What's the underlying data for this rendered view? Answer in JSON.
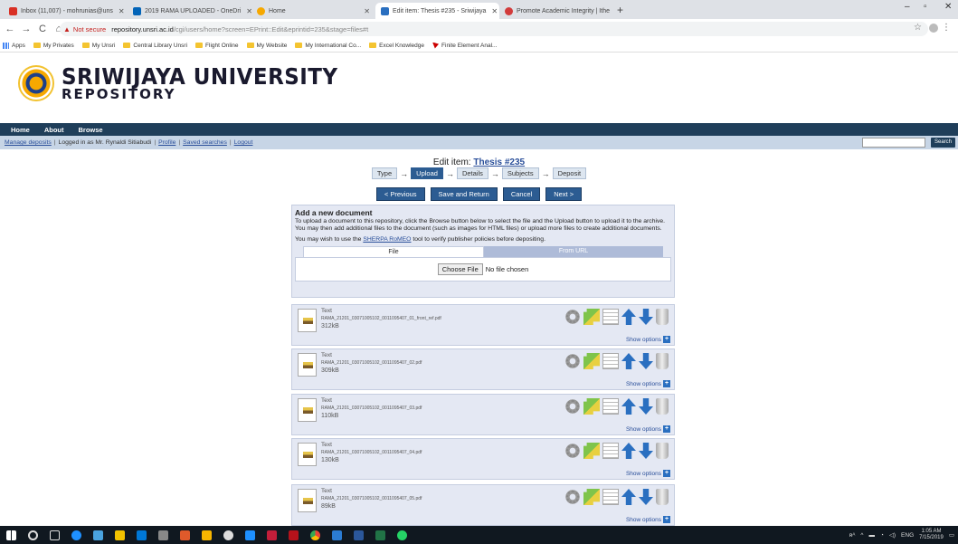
{
  "tabs": [
    {
      "title": "Inbox (11,007) - mohrunias@uns",
      "icon": "gmail-icon",
      "color": "#d93025"
    },
    {
      "title": "2019 RAMA UPLOADED - OneDri",
      "icon": "onedrive-icon",
      "color": "#0364b8"
    },
    {
      "title": "Home",
      "icon": "sriwijaya-icon",
      "color": "#f6a800"
    },
    {
      "title": "Edit item: Thesis #235 - Sriwijaya",
      "icon": "eprints-icon",
      "color": "#2a6fc0"
    },
    {
      "title": "Promote Academic Integrity | Ithe",
      "icon": "ithenticate-icon",
      "color": "#d23b3b"
    }
  ],
  "address": {
    "not_secure": "Not secure",
    "host": "repository.unsri.ac.id",
    "path": "/cgi/users/home?screen=EPrint::Edit&eprintid=235&stage=files#t"
  },
  "bookmarks": [
    "Apps",
    "My Privates",
    "My Unsri",
    "Central Library Unsri",
    "Flight Online",
    "My Website",
    "My International Co...",
    "Excel Knowledge",
    "Finite Element Anal..."
  ],
  "site": {
    "name": "SRIWIJAYA UNIVERSITY",
    "sub": "REPOSITORY"
  },
  "menu": [
    "Home",
    "About",
    "Browse"
  ],
  "userbar": {
    "manage": "Manage deposits",
    "logged": "Logged in as Mr. Rynaldi Sitiabudi",
    "profile": "Profile",
    "saved": "Saved searches",
    "logout": "Logout",
    "search_btn": "Search"
  },
  "edit": {
    "prefix": "Edit item: ",
    "item": "Thesis #235"
  },
  "steps": [
    "Type",
    "Upload",
    "Details",
    "Subjects",
    "Deposit"
  ],
  "buttons": {
    "prev": "< Previous",
    "save": "Save and Return",
    "cancel": "Cancel",
    "next": "Next >"
  },
  "upload_panel": {
    "heading": "Add a new document",
    "text1": "To upload a document to this repository, click the Browse button below to select the file and the Upload button to upload it to the archive. You may then add additional files to the document (such as images for HTML files) or upload more files to create additional documents.",
    "text2_pre": "You may wish to use the ",
    "text2_link": "SHERPA RoMEO",
    "text2_post": " tool to verify publisher policies before depositing.",
    "tab_file": "File",
    "tab_url": "From URL",
    "choose": "Choose File",
    "no_file": "No file chosen"
  },
  "documents": [
    {
      "type": "Text",
      "name": "RAMA_21201_03071005102_0011095407_01_front_ref.pdf",
      "size": "312kB",
      "show": "Show options"
    },
    {
      "type": "Text",
      "name": "RAMA_21201_03071005102_0011095407_02.pdf",
      "size": "309kB",
      "show": "Show options"
    },
    {
      "type": "Text",
      "name": "RAMA_21201_03071005102_0011095407_03.pdf",
      "size": "110kB",
      "show": "Show options"
    },
    {
      "type": "Text",
      "name": "RAMA_21201_03071005102_0011095407_04.pdf",
      "size": "130kB",
      "show": "Show options"
    },
    {
      "type": "Text",
      "name": "RAMA_21201_03071005102_0011095407_05.pdf",
      "size": "89kB",
      "show": "Show options"
    }
  ],
  "taskbar": {
    "lang": "ENG",
    "time": "1:05 AM",
    "date": "7/15/2019"
  }
}
